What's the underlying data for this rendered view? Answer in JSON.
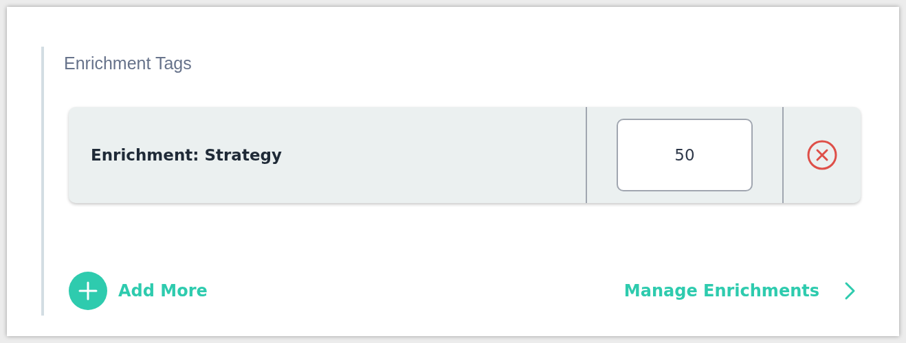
{
  "section": {
    "title": "Enrichment Tags"
  },
  "tags": [
    {
      "name": "Enrichment: Strategy",
      "value": "50"
    }
  ],
  "footer": {
    "add_label": "Add More",
    "manage_label": "Manage Enrichments"
  }
}
